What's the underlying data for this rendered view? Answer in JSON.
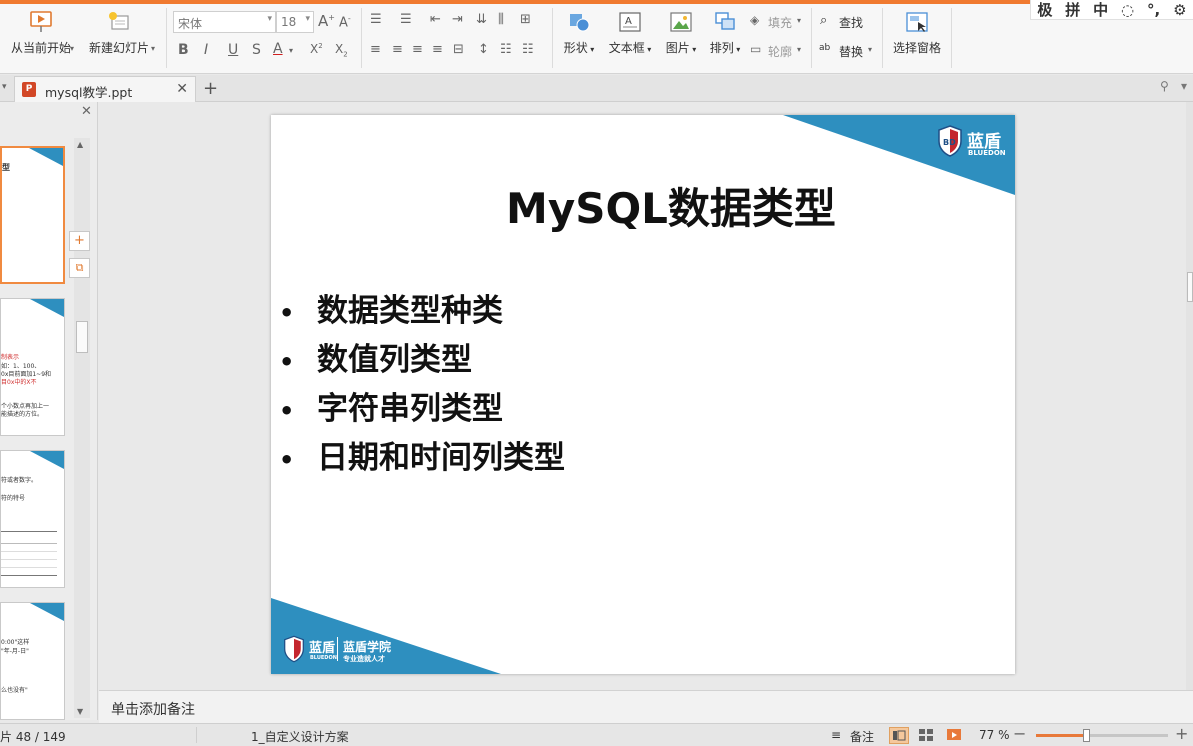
{
  "ribbon": {
    "from_current": "从当前开始",
    "new_slide": "新建幻灯片",
    "font_name": "宋体",
    "font_size": "18",
    "shape": "形状",
    "textbox": "文本框",
    "picture": "图片",
    "arrange": "排列",
    "fill": "填充",
    "outline": "轮廓",
    "find": "查找",
    "replace": "替换",
    "select_pane": "选择窗格"
  },
  "ime": [
    "极",
    "拼",
    "中",
    "◌",
    "°,",
    "⚙"
  ],
  "tabs": {
    "file_name": "mysql教学.ppt"
  },
  "thumbnails": [
    {
      "lines": [
        {
          "text": "型",
          "red": false
        }
      ]
    },
    {
      "lines": [
        {
          "text": "制表示",
          "red": true
        },
        {
          "text": "如：1、100、",
          "red": false
        },
        {
          "text": "0x目前面加1~9和",
          "red": false
        },
        {
          "text": "目0x中的X不",
          "red": true
        },
        {
          "text": "",
          "red": false
        },
        {
          "text": "个小数点再加上一",
          "red": false
        },
        {
          "text": "能描述的方位。",
          "red": false
        }
      ]
    },
    {
      "lines": [
        {
          "text": "符或者数字。",
          "red": false
        },
        {
          "text": "",
          "red": false
        },
        {
          "text": "符的特号",
          "red": false
        }
      ]
    },
    {
      "lines": [
        {
          "text": "0:00\"这样",
          "red": false
        },
        {
          "text": "\"年-月-日\"",
          "red": false
        },
        {
          "text": "",
          "red": false
        },
        {
          "text": "么也没有\"",
          "red": false
        }
      ]
    }
  ],
  "slide": {
    "title": "MySQL数据类型",
    "bullets": [
      "数据类型种类",
      "数值列类型",
      "字符串列类型",
      "日期和时间列类型"
    ],
    "logo_cn": "蓝盾",
    "logo_en": "BLUEDON",
    "footer_logo_cn": "蓝盾",
    "footer_logo_en": "BLUEDON",
    "footer_school": "蓝盾学院",
    "footer_slogan": "专业造就人才",
    "bullet_symbol": "•"
  },
  "notes": {
    "placeholder": "单击添加备注"
  },
  "status": {
    "slide_counter": "片 48 / 149",
    "theme": "1_自定义设计方案",
    "notes_btn": "备注",
    "zoom_text": "77 %",
    "zoom_level": 0.38
  },
  "colors": {
    "accent": "#f07a30",
    "slide_blue": "#2e8fbf"
  }
}
